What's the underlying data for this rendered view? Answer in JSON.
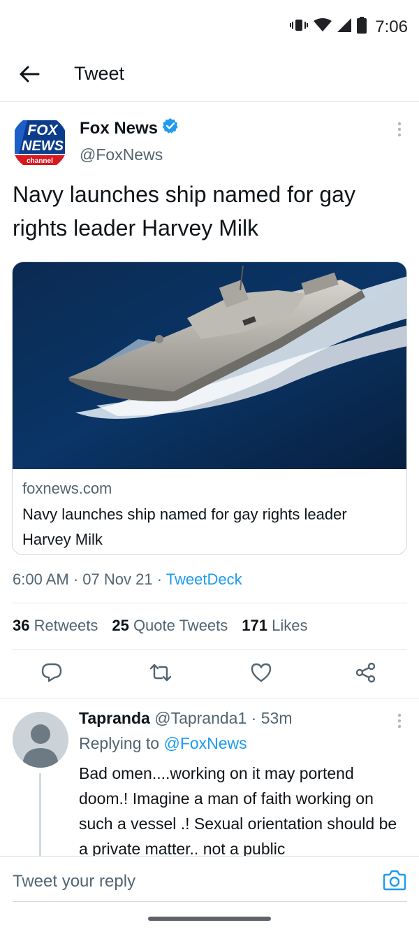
{
  "status_bar": {
    "time": "7:06",
    "icons": [
      "vibrate-icon",
      "wifi-icon",
      "signal-icon",
      "battery-icon"
    ]
  },
  "header": {
    "title": "Tweet",
    "back_icon": "arrow-left-icon"
  },
  "tweet": {
    "author": {
      "name": "Fox News",
      "handle": "@FoxNews",
      "verified": true,
      "avatar_logo_lines": [
        "FOX",
        "NEWS",
        "channel"
      ]
    },
    "text": "Navy launches ship named for gay rights leader Harvey Milk",
    "card": {
      "domain": "foxnews.com",
      "title": "Navy launches ship named for gay rights leader Harvey Milk"
    },
    "meta": {
      "time": "6:00 AM",
      "date": "07 Nov 21",
      "source": "TweetDeck",
      "separator": "·"
    },
    "stats": [
      {
        "count": "36",
        "label": "Retweets"
      },
      {
        "count": "25",
        "label": "Quote Tweets"
      },
      {
        "count": "171",
        "label": "Likes"
      }
    ],
    "actions": [
      "reply-icon",
      "retweet-icon",
      "like-icon",
      "share-icon"
    ]
  },
  "reply": {
    "name": "Tapranda",
    "handle": "@Tapranda1",
    "separator": "·",
    "time": "53m",
    "replying_prefix": "Replying to",
    "replying_to": "@FoxNews",
    "text": "Bad omen....working on it may portend doom.! Imagine a man of faith working on such a vessel .! Sexual orientation should be a private matter.. not a public"
  },
  "compose": {
    "placeholder": "Tweet your reply",
    "camera_icon": "camera-icon"
  },
  "colors": {
    "accent": "#1d9bf0",
    "text": "#0f1419",
    "muted": "#536471",
    "divider": "#e3e7ea"
  }
}
